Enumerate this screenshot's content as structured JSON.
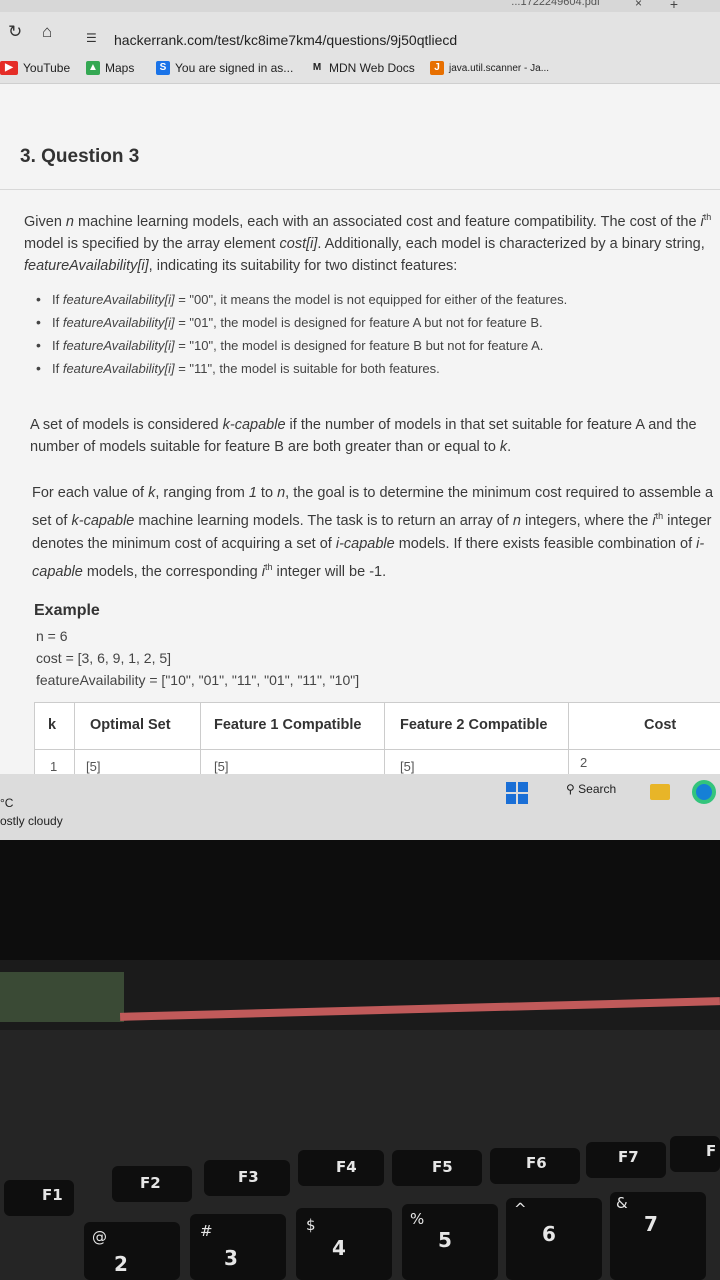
{
  "browser": {
    "tab_title": "...1722249604.pdf",
    "close_glyph": "×",
    "new_tab_glyph": "+",
    "url": "hackerrank.com/test/kc8ime7km4/questions/9j50qtliecd",
    "bookmarks": [
      {
        "label": "YouTube",
        "icon": "youtube-icon",
        "color": "#e52d27"
      },
      {
        "label": "Maps",
        "icon": "maps-icon",
        "color": "#34a853"
      },
      {
        "label": "You are signed in as...",
        "icon": "s-icon",
        "color": "#1a73e8"
      },
      {
        "label": "MDN Web Docs",
        "icon": "mdn-icon",
        "color": "#222222"
      },
      {
        "label": "java.util.scanner - Ja...",
        "icon": "java-icon",
        "color": "#e76f00"
      }
    ]
  },
  "question": {
    "title": "3. Question 3",
    "intro_1": "Given ",
    "intro_n": "n",
    "intro_2": " machine learning models, each with an associated cost and feature compatibility. The cost of the ",
    "intro_i": "i",
    "intro_th": "th",
    "intro_3": " model is specified by the array element ",
    "intro_cost": "cost[i]",
    "intro_4": ". Additionally, each model is characterized by a binary string, ",
    "intro_fa": "featureAvailability[i]",
    "intro_5": ", indicating its suitability for two distinct features:",
    "bullets": [
      {
        "lead": "If ",
        "code": "featureAvailability[i]",
        "rest": " = \"00\", it means the model is not equipped for either of the features."
      },
      {
        "lead": "If ",
        "code": "featureAvailability[i]",
        "rest": " = \"01\", the model is designed for feature A but not for feature B."
      },
      {
        "lead": "If ",
        "code": "featureAvailability[i]",
        "rest": " = \"10\", the model is designed for feature B but not for feature A."
      },
      {
        "lead": "If ",
        "code": "featureAvailability[i]",
        "rest": " = \"11\", the model is suitable for both features."
      }
    ],
    "kcap_1": "A set of models is considered ",
    "kcap_term": "k-capable",
    "kcap_2": " if the number of models in that set suitable for feature A and the number of models suitable for feature B are both greater than or equal to ",
    "kcap_k": "k",
    "kcap_3": ".",
    "goal_1": "For each value of ",
    "goal_k": "k",
    "goal_2": ", ranging from ",
    "goal_1v": "1",
    "goal_3": " to ",
    "goal_n": "n",
    "goal_4": ", the goal is to determine the minimum cost required to assemble a set of ",
    "goal_kcap": "k-capable",
    "goal_5": " machine learning models. The task is to return an array of ",
    "goal_n2": "n",
    "goal_6": " integers, where the ",
    "goal_i": "i",
    "goal_th": "th",
    "goal_7": " integer denotes the minimum cost of acquiring a set of ",
    "goal_icap": "i-capable",
    "goal_8": " models. If there exists feasible combination of ",
    "goal_icap2": "i-capable",
    "goal_9": " models, the corresponding ",
    "goal_i2": "i",
    "goal_th2": "th",
    "goal_10": " integer will be -1.",
    "example_title": "Example",
    "ex_n": "n = 6",
    "ex_cost": "cost = [3, 6, 9, 1, 2, 5]",
    "ex_fa": "featureAvailability = [\"10\", \"01\", \"11\", \"01\", \"11\", \"10\"]"
  },
  "table": {
    "headers": [
      "k",
      "Optimal Set",
      "Feature 1 Compatible",
      "Feature 2 Compatible",
      "Cost"
    ],
    "row": [
      "1",
      "[5]",
      "[5]",
      "[5]",
      "2"
    ]
  },
  "taskbar": {
    "temp": "°C",
    "weather": "ostly cloudy",
    "search": "Search"
  },
  "keyboard": {
    "fkeys": [
      "F1",
      "F2",
      "F3",
      "F4",
      "F5",
      "F6",
      "F7",
      "F"
    ],
    "numbers": [
      {
        "main": "2",
        "sub": "@"
      },
      {
        "main": "3",
        "sub": "#"
      },
      {
        "main": "4",
        "sub": "$"
      },
      {
        "main": "5",
        "sub": "%"
      },
      {
        "main": "6",
        "sub": "^"
      },
      {
        "main": "7",
        "sub": "&"
      }
    ]
  }
}
